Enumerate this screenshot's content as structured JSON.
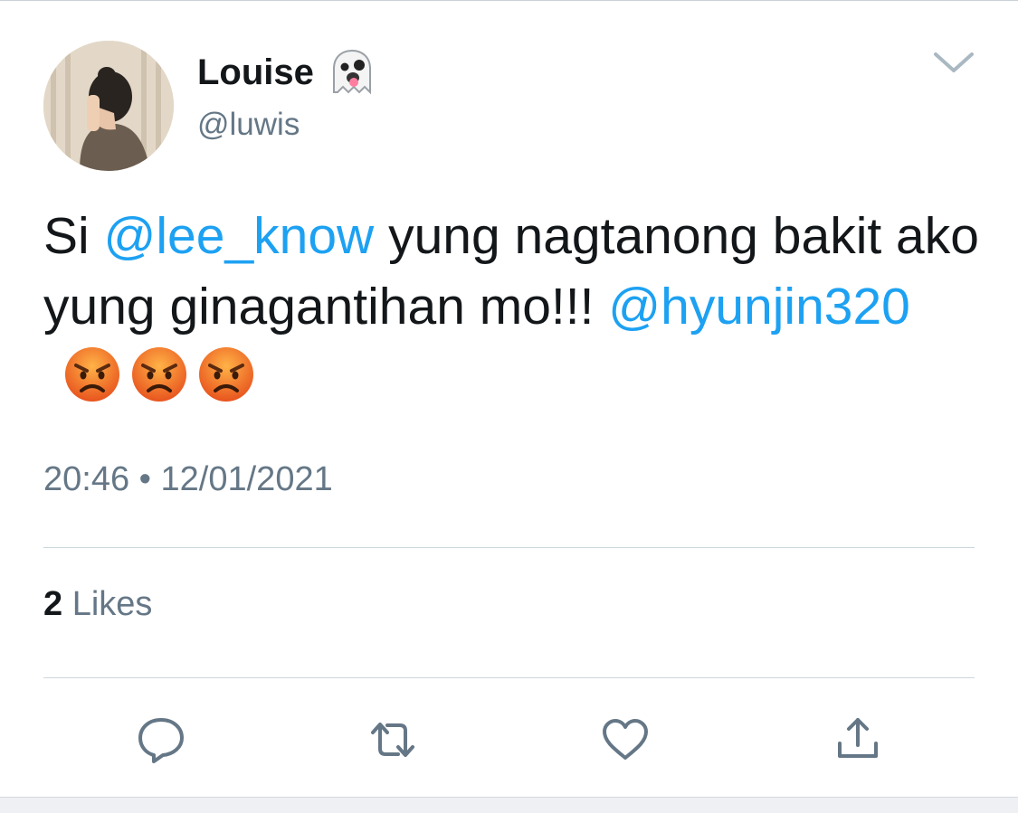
{
  "user": {
    "display_name": "Louise",
    "handle": "@luwis"
  },
  "tweet": {
    "text_segments": [
      "Si ",
      "@lee_know",
      " yung nagtanong bakit ako yung ginagantihan mo!!! ",
      "@hyunjin320"
    ],
    "emoji": [
      "angry-face",
      "angry-face",
      "angry-face"
    ],
    "time": "20:46",
    "separator": "•",
    "date": "12/01/2021"
  },
  "stats": {
    "likes_count": "2",
    "likes_label": "Likes"
  },
  "actions": [
    "reply-icon",
    "retweet-icon",
    "like-icon",
    "share-icon"
  ],
  "colors": {
    "link": "#1da1f2",
    "text": "#14171a",
    "muted": "#657786",
    "divider": "#ccd6dd"
  }
}
